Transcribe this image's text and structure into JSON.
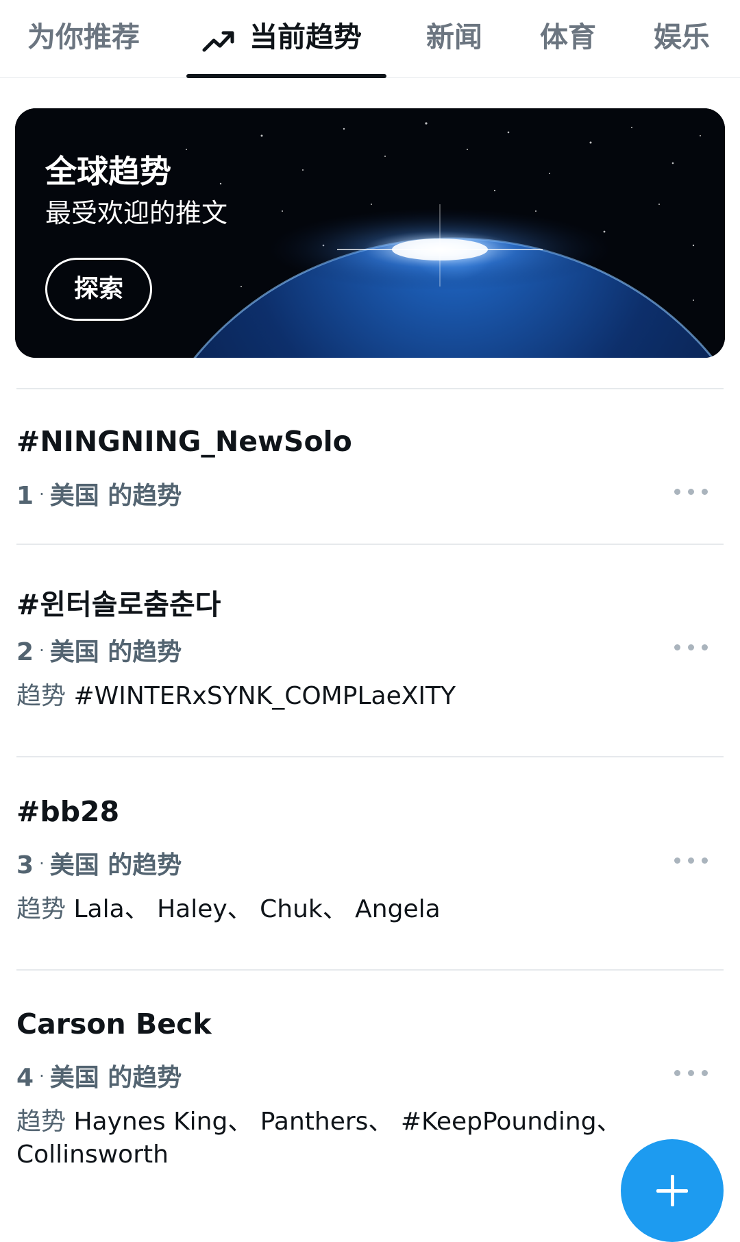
{
  "tabs": [
    {
      "label": "为你推荐",
      "active": false
    },
    {
      "label": "当前趋势",
      "active": true,
      "icon": "trending-icon"
    },
    {
      "label": "新闻",
      "active": false
    },
    {
      "label": "体育",
      "active": false
    },
    {
      "label": "娱乐",
      "active": false
    }
  ],
  "hero": {
    "title": "全球趋势",
    "subtitle": "最受欢迎的推文",
    "button_label": "探索"
  },
  "trends": [
    {
      "rank": "1",
      "title": "#NINGNING_NewSolo",
      "context": "美国 的趋势",
      "related_prefix": "",
      "related": ""
    },
    {
      "rank": "2",
      "title": "#윈터솔로춤춘다",
      "context": "美国 的趋势",
      "related_prefix": "趋势",
      "related": "#WINTERxSYNK_COMPLaeXITY"
    },
    {
      "rank": "3",
      "title": "#bb28",
      "context": "美国 的趋势",
      "related_prefix": "趋势",
      "related": "Lala、 Haley、 Chuk、 Angela"
    },
    {
      "rank": "4",
      "title": "Carson Beck",
      "context": "美国 的趋势",
      "related_prefix": "趋势",
      "related": "Haynes King、 Panthers、 #KeepPounding、 Collinsworth"
    }
  ],
  "colors": {
    "accent": "#1d9bf0",
    "text_primary": "#0f1419",
    "text_secondary": "#536471",
    "divider": "#e6e9ec"
  },
  "fab": {
    "icon": "plus-icon"
  }
}
